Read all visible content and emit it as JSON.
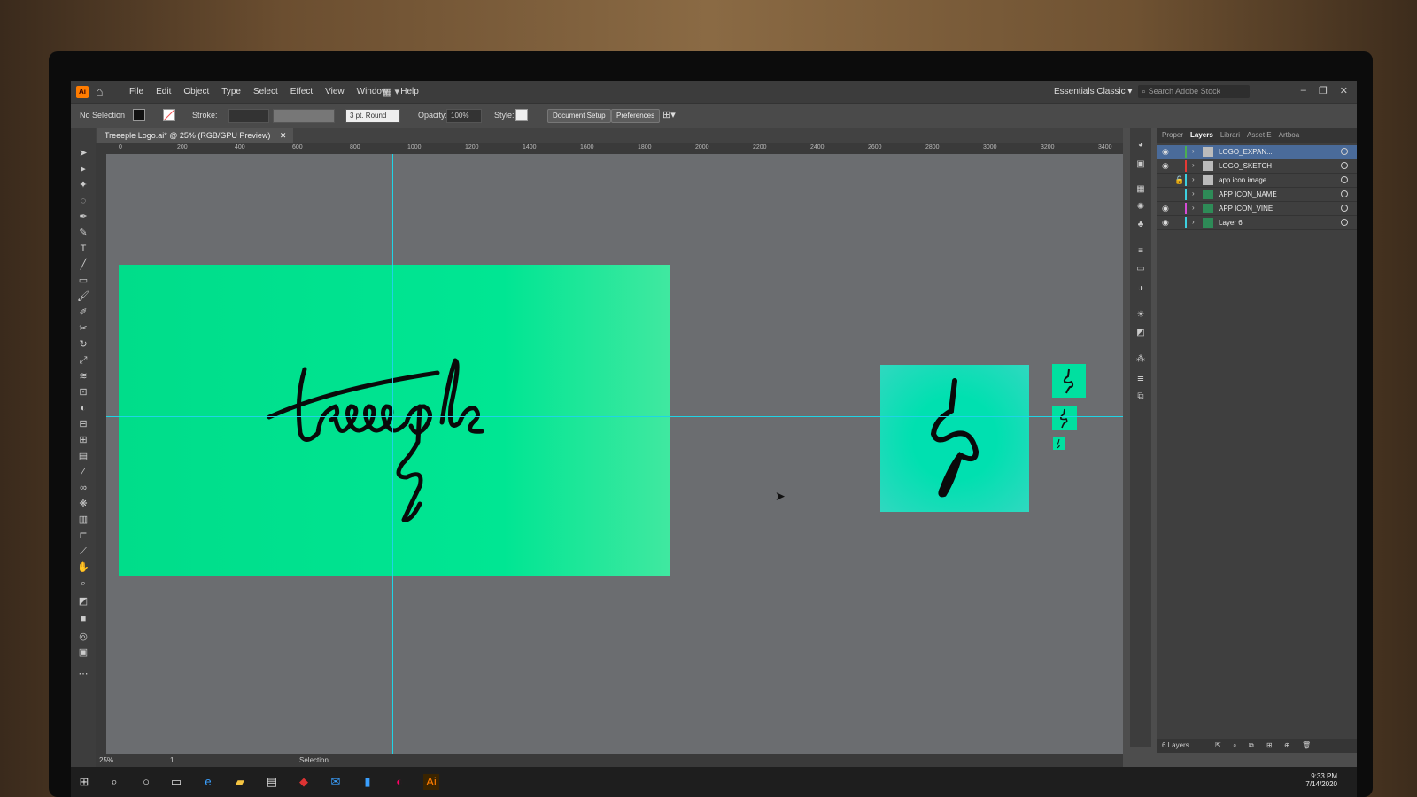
{
  "app": {
    "logo": "Ai",
    "menus": [
      "File",
      "Edit",
      "Object",
      "Type",
      "Select",
      "Effect",
      "View",
      "Window",
      "Help"
    ],
    "workspace": "Essentials Classic",
    "stock_placeholder": "Search Adobe Stock"
  },
  "control_bar": {
    "selection": "No Selection",
    "stroke_label": "Stroke:",
    "brush": "3 pt. Round",
    "opacity_label": "Opacity:",
    "opacity_value": "100%",
    "style_label": "Style:",
    "doc_setup": "Document Setup",
    "preferences": "Preferences"
  },
  "document": {
    "tab_title": "Treeeple Logo.ai* @ 25% (RGB/GPU Preview)"
  },
  "ruler": [
    "0",
    "200",
    "400",
    "600",
    "800",
    "1000",
    "1200",
    "1400",
    "1600",
    "1800",
    "2000",
    "2200",
    "2400",
    "2600",
    "2800",
    "3000",
    "3200",
    "3400"
  ],
  "artwork": {
    "wordmark": "treeeple"
  },
  "layers_panel": {
    "tabs": [
      "Proper",
      "Layers",
      "Librari",
      "Asset E",
      "Artboa"
    ],
    "layers": [
      {
        "name": "LOGO_EXPAN...",
        "color": "#4caf50"
      },
      {
        "name": "LOGO_SKETCH",
        "color": "#e53935"
      },
      {
        "name": "app icon image",
        "color": "#3dd0e0"
      },
      {
        "name": "APP ICON_NAME",
        "color": "#3dd0e0"
      },
      {
        "name": "APP ICON_VINE",
        "color": "#d64bd6"
      },
      {
        "name": "Layer 6",
        "color": "#3dd0e0"
      }
    ],
    "footer": "6 Layers"
  },
  "status": {
    "zoom": "25%",
    "artboard": "1",
    "tool": "Selection"
  },
  "taskbar": {
    "time": "9:33 PM",
    "date": "7/14/2020"
  }
}
